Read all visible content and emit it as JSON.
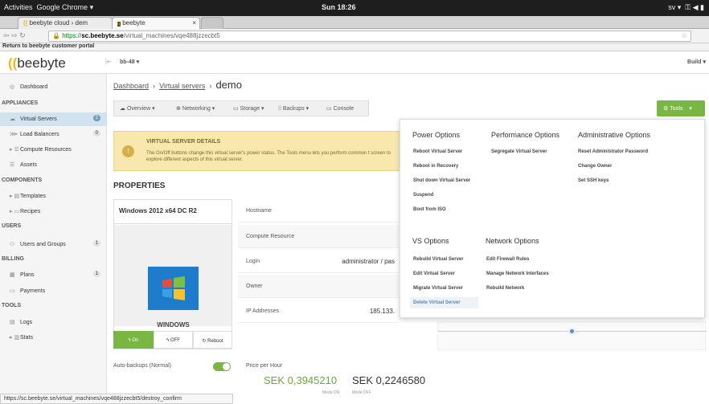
{
  "gnome": {
    "activities": "Activities",
    "app": "Google Chrome ▾",
    "clock": "Sun 18:26",
    "right": "sv ▾"
  },
  "tabs": [
    {
      "label": "beebyte cloud › dem"
    },
    {
      "label": "beebyte"
    }
  ],
  "address": {
    "scheme": "https://",
    "host": "sc.beebyte.se",
    "path": "/virtual_machines/vqe488jzzecbt5"
  },
  "bookmark": "Return to beebyte customer portal",
  "logo": "beebyte",
  "header": {
    "server": "bb-48",
    "build": "Build"
  },
  "sidebar": {
    "items": [
      {
        "label": "Dashboard"
      },
      {
        "label": "Virtual Servers",
        "count": "2"
      },
      {
        "label": "Load Balancers",
        "count": "0"
      },
      {
        "label": "Compute Resources"
      },
      {
        "label": "Assets"
      },
      {
        "label": "Templates"
      },
      {
        "label": "Recipes"
      },
      {
        "label": "Users and Groups",
        "count": "1"
      },
      {
        "label": "Plans",
        "count": "1"
      },
      {
        "label": "Payments"
      },
      {
        "label": "Logs"
      },
      {
        "label": "Stats"
      }
    ],
    "sections": {
      "appliances": "APPLIANCES",
      "components": "COMPONENTS",
      "users": "USERS",
      "billing": "BILLING",
      "tools": "TOOLS"
    }
  },
  "breadcrumb": {
    "dashboard": "Dashboard",
    "sep": "›",
    "vs": "Virtual servers",
    "current": "demo"
  },
  "toolbar": {
    "overview": "Overview",
    "networking": "Networking",
    "storage": "Storage",
    "backups": "Backups",
    "console": "Console",
    "tools": "Tools"
  },
  "notice": {
    "title": "VIRTUAL SERVER DETAILS",
    "text": "The On/Off buttons change this virtual server's power status. The Tools menu lets you perform common t screen to explore different aspects of this virtual server."
  },
  "properties": {
    "heading": "PROPERTIES",
    "os_name": "Windows 2012 x64 DC R2",
    "os_label": "WINDOWS",
    "power": {
      "on": "On",
      "off": "OFF",
      "reboot": "Reboot"
    },
    "rows": [
      {
        "key": "Hostname",
        "value": ""
      },
      {
        "key": "Compute Resource",
        "value": ""
      },
      {
        "key": "Login",
        "value": "administrator / pas"
      },
      {
        "key": "Owner",
        "value": ""
      },
      {
        "key": "IP Addresses",
        "value": "185.133."
      }
    ],
    "auto_backups": "Auto-backups (Normal)",
    "price_label": "Price per Hour",
    "price_on": "SEK 0,3945210",
    "price_off": "SEK 0,2246580",
    "mode_on": "Mode ON",
    "mode_off": "Mode OFF"
  },
  "menu": {
    "power": {
      "title": "Power Options",
      "items": [
        "Reboot Virtual Server",
        "Reboot in Recovery",
        "Shut down Virtual Server",
        "Suspend",
        "Boot from ISO"
      ]
    },
    "performance": {
      "title": "Performance Options",
      "items": [
        "Segregate Virtual Server"
      ]
    },
    "admin": {
      "title": "Administrative Options",
      "items": [
        "Reset Administrator Password",
        "Change Owner",
        "Set SSH keys"
      ]
    },
    "vs": {
      "title": "VS Options",
      "items": [
        "Rebuild Virtual Server",
        "Edit Virtual Server",
        "Migrate Virtual Server",
        "Delete Virtual Server"
      ]
    },
    "network": {
      "title": "Network Options",
      "items": [
        "Edit Firewall Rules",
        "Manage Network Interfaces",
        "Rebuild Network"
      ]
    }
  },
  "statusbar": "https://sc.beebyte.se/virtual_machines/vqe488jzzecbt5/destroy_confirm",
  "colors": {
    "accent": "#7ab642",
    "logo": "#f2b818",
    "selected": "#d1e3ee"
  }
}
